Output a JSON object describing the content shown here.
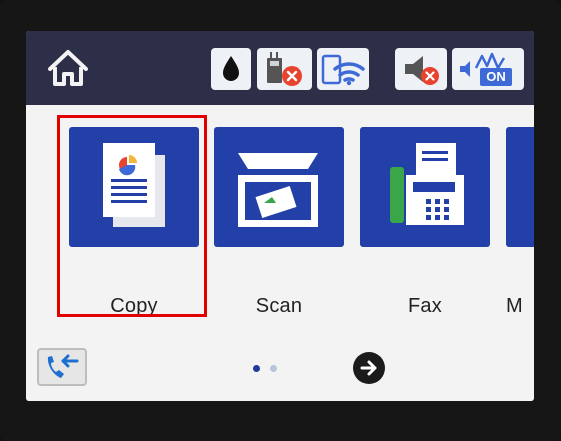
{
  "status_icons": [
    "home-icon",
    "ink-icon",
    "network-error-icon",
    "wifi-icon",
    "sound-muted-icon",
    "quiet-mode-on-icon"
  ],
  "quiet_mode_badge": "ON",
  "menu": {
    "items": [
      {
        "label": "Copy",
        "icon": "copy-icon",
        "selected": true
      },
      {
        "label": "Scan",
        "icon": "scan-icon",
        "selected": false
      },
      {
        "label": "Fax",
        "icon": "fax-icon",
        "selected": false
      },
      {
        "label": "M",
        "icon": "partial-menu-icon",
        "selected": false
      }
    ]
  },
  "pagination": {
    "current_page": 1,
    "total_pages": 2
  },
  "colors": {
    "accent": "#2240a8",
    "status_bar": "#2d2e48",
    "selection": "#e00000"
  }
}
